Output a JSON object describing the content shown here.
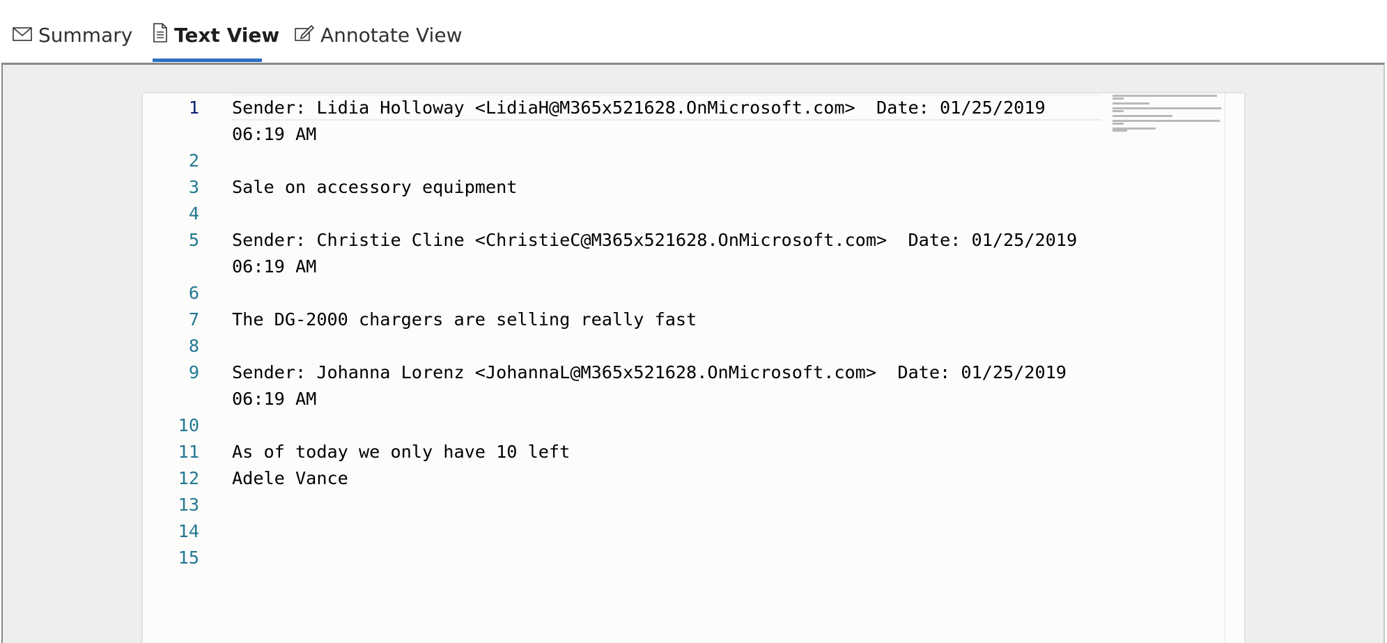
{
  "tabs": [
    {
      "label": "Summary",
      "icon": "mail-icon"
    },
    {
      "label": "Text View",
      "icon": "document-icon",
      "active": true
    },
    {
      "label": "Annotate View",
      "icon": "edit-icon"
    }
  ],
  "editor": {
    "line_numbers": [
      "1",
      "",
      "2",
      "3",
      "4",
      "5",
      "",
      "6",
      "7",
      "8",
      "9",
      "",
      "10",
      "11",
      "12",
      "13",
      "14",
      "15"
    ],
    "lines": [
      "Sender: Lidia Holloway <LidiaH@M365x521628.OnMicrosoft.com>  Date: 01/25/2019",
      "06:19 AM",
      "",
      "Sale on accessory equipment",
      "",
      "Sender: Christie Cline <ChristieC@M365x521628.OnMicrosoft.com>  Date: 01/25/2019",
      "06:19 AM",
      "",
      "The DG-2000 chargers are selling really fast",
      "",
      "Sender: Johanna Lorenz <JohannaL@M365x521628.OnMicrosoft.com>  Date: 01/25/2019",
      "06:19 AM",
      "",
      "As of today we only have 10 left",
      "Adele Vance",
      "",
      "",
      ""
    ]
  },
  "colors": {
    "accent": "#2b6fc2",
    "line_number": "#237893",
    "current_line_number": "#0b216f"
  }
}
